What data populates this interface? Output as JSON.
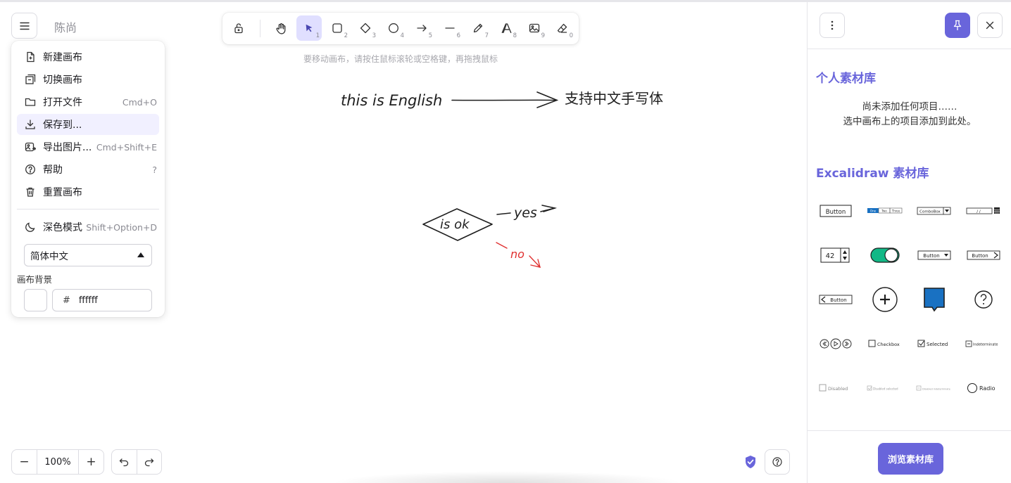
{
  "app": {
    "title": "陈尚"
  },
  "menu": {
    "items": [
      {
        "label": "新建画布",
        "shortcut": "",
        "icon": "new-canvas-icon"
      },
      {
        "label": "切换画布",
        "shortcut": "",
        "icon": "switch-canvas-icon"
      },
      {
        "label": "打开文件",
        "shortcut": "Cmd+O",
        "icon": "folder-icon"
      },
      {
        "label": "保存到...",
        "shortcut": "",
        "icon": "download-icon"
      },
      {
        "label": "导出图片...",
        "shortcut": "Cmd+Shift+E",
        "icon": "export-image-icon"
      },
      {
        "label": "帮助",
        "shortcut": "?",
        "icon": "help-icon"
      },
      {
        "label": "重置画布",
        "shortcut": "",
        "icon": "trash-icon"
      }
    ],
    "dark_mode": {
      "label": "深色模式",
      "shortcut": "Shift+Option+D",
      "icon": "moon-icon"
    },
    "language": {
      "selected": "简体中文"
    },
    "canvas_background": {
      "label": "画布背景",
      "hash": "#",
      "value": "ffffff"
    }
  },
  "toolbar": {
    "tools": [
      {
        "name": "lock",
        "num": ""
      },
      {
        "name": "hand",
        "num": ""
      },
      {
        "name": "selection",
        "num": "1",
        "active": true
      },
      {
        "name": "rectangle",
        "num": "2"
      },
      {
        "name": "diamond",
        "num": "3"
      },
      {
        "name": "ellipse",
        "num": "4"
      },
      {
        "name": "arrow",
        "num": "5"
      },
      {
        "name": "line",
        "num": "6"
      },
      {
        "name": "freedraw",
        "num": "7"
      },
      {
        "name": "text",
        "num": "8"
      },
      {
        "name": "image",
        "num": "9"
      },
      {
        "name": "eraser",
        "num": "0"
      }
    ],
    "hint": "要移动画布，请按住鼠标滚轮或空格键，再拖拽鼠标"
  },
  "canvas": {
    "text_english": "this is English",
    "text_chinese": "支持中文手写体",
    "diamond_label": "is ok",
    "yes_label": "yes",
    "no_label": "no",
    "accent_red": "#e03131",
    "stroke": "#1e1e1e"
  },
  "footer": {
    "zoom_out": "−",
    "zoom_value": "100%",
    "zoom_in": "+"
  },
  "library": {
    "personal_title": "个人素材库",
    "empty_line1": "尚未添加任何项目……",
    "empty_line2": "选中画布上的项目添加到此处。",
    "excalidraw_title": "Excalidraw 素材库",
    "items": {
      "button": "Button",
      "combobox": "ComboBox",
      "date": "/ /",
      "number": "42",
      "button_dropdown": "Button",
      "button_next": "Button",
      "button_back": "Button",
      "checkbox": "Checkbox",
      "selected": "Selected",
      "indeterminate": "Indeterminate",
      "disabled": "Disabled",
      "disabled_selected": "Disabled selected",
      "disabled_indeterminate": "Disabled indeterminate",
      "radio": "Radio",
      "tab1": "One",
      "tab2": "Two",
      "tab3": "Three"
    },
    "browse_label": "浏览素材库",
    "accent": "#6965db"
  }
}
